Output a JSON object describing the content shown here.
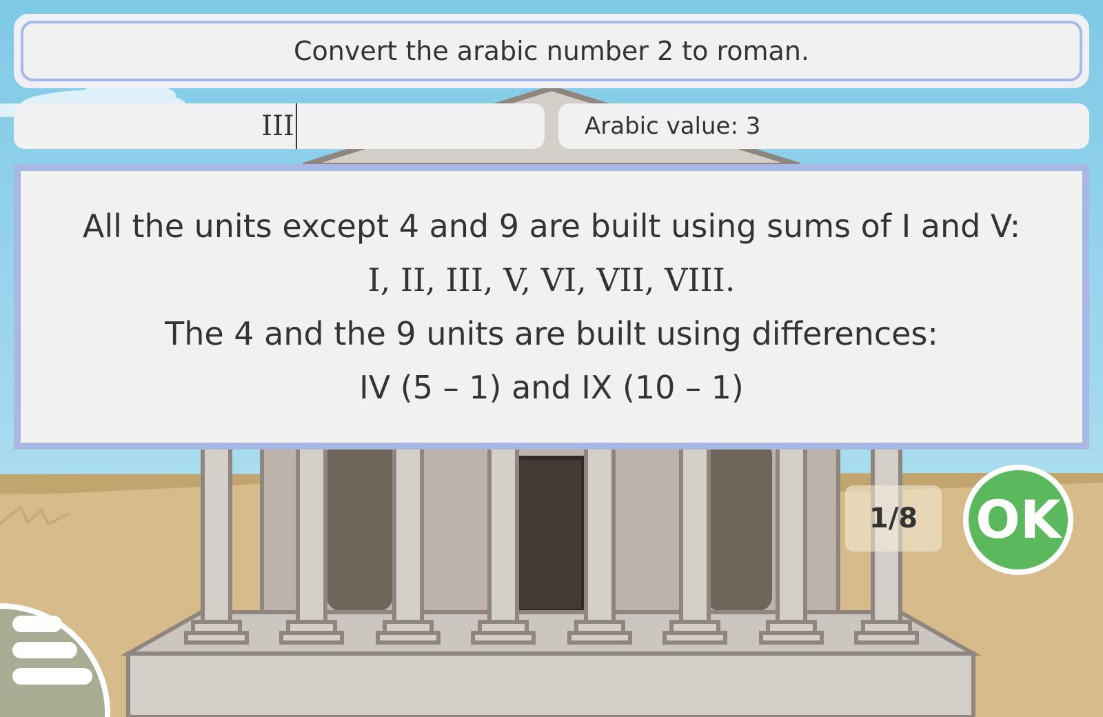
{
  "question": "Convert the arabic number 2 to roman.",
  "answer_input": {
    "value": "III"
  },
  "arabic_value": "Arabic value: 3",
  "hint": {
    "lines": [
      "All the units except 4 and 9 are built using sums of I and V:",
      "I, II, III, V, VI, VII, VIII.",
      "The 4 and the 9 units are built using differences:",
      "IV (5 – 1) and IX (10 – 1)"
    ]
  },
  "progress": "1/8",
  "ok_button": {
    "label": "OK",
    "color": "#5cb85c",
    "icon": "ok-icon"
  },
  "menu_button": {
    "icon": "hamburger-menu-icon",
    "color": "#a8ac92"
  },
  "colors": {
    "sky": "#85cde8",
    "accent_border": "#a7b8e4",
    "panel": "#f1f1f1",
    "text": "#333333"
  }
}
